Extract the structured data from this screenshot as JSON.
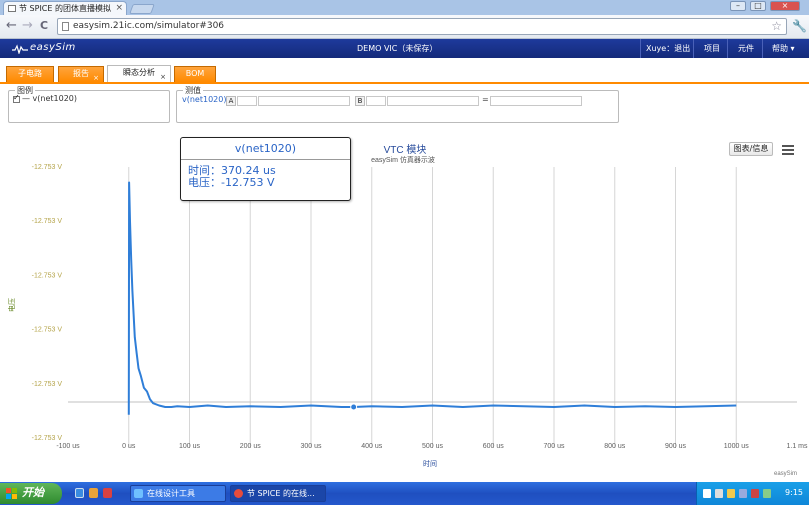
{
  "browser": {
    "tab_title": "节 SPICE 的团体直播模拟",
    "tab_close": "×",
    "url": "easysim.21ic.com/simulator#306",
    "nav_back": "←",
    "nav_forward": "→",
    "nav_reload": "C",
    "star": "☆",
    "wrench": "🔧",
    "win_min": "–",
    "win_max": "□",
    "win_close": "×"
  },
  "app": {
    "logo_text": "easySim",
    "center_title": "DEMO VIC（未保存）",
    "nav": [
      {
        "label": "Xuye：退出"
      },
      {
        "label": "项目"
      },
      {
        "label": "元件"
      },
      {
        "label": "帮助 ▾"
      }
    ]
  },
  "tabs": [
    {
      "label": "子电路",
      "closable": false,
      "active": false
    },
    {
      "label": "报告",
      "closable": true,
      "active": false
    },
    {
      "label": "瞬态分析",
      "closable": true,
      "active": true
    },
    {
      "label": "BOM",
      "closable": false,
      "active": false
    }
  ],
  "signals_panel": {
    "legend": "图例",
    "item": "— v(net1020)"
  },
  "calc_panel": {
    "legend": "测值",
    "signal": "v(net1020)",
    "a_label": "A",
    "b_label": "B",
    "eq": "="
  },
  "chart_tools": {
    "reset_label": "图表/信息",
    "menu_icon": "menu-icon"
  },
  "tooltip": {
    "series": "v(net1020)",
    "time_line": "时间：370.24 us",
    "value_line": "电压：-12.753 V"
  },
  "chart_data": {
    "type": "line",
    "title": "VTC 模块",
    "subtitle": "easySim 仿真器示波",
    "xlabel": "时间",
    "ylabel": "电压",
    "xlim": [
      -100,
      1100
    ],
    "ylim": [
      -12.75335,
      -12.753
    ],
    "x_ticks": [
      "-100 us",
      "0 us",
      "100 us",
      "200 us",
      "300 us",
      "400 us",
      "500 us",
      "600 us",
      "700 us",
      "800 us",
      "900 us",
      "1000 us",
      "1.1 ms"
    ],
    "y_ticks": [
      "-12.753 V",
      "-12.753 V",
      "-12.753 V",
      "-12.753 V",
      "-12.753 V",
      "-12.753 V"
    ],
    "credit": "easySim",
    "series": [
      {
        "color": "#2f7ed8",
        "x": [
          0,
          0.5,
          2,
          4,
          6,
          8,
          10,
          13,
          16,
          20,
          25,
          30,
          35,
          40,
          50,
          60,
          70,
          80,
          100,
          130,
          160,
          200,
          250,
          300,
          350,
          370.24,
          400,
          450,
          500,
          550,
          600,
          650,
          700,
          750,
          800,
          850,
          900,
          950,
          1000
        ],
        "y": [
          -12.75332,
          -12.75302,
          -12.75307,
          -12.75312,
          -12.75316,
          -12.75319,
          -12.75322,
          -12.75324,
          -12.75326,
          -12.75327,
          -12.753285,
          -12.75329,
          -12.7533,
          -12.753305,
          -12.753308,
          -12.75331,
          -12.75331,
          -12.753309,
          -12.75331,
          -12.753308,
          -12.75331,
          -12.753309,
          -12.75331,
          -12.753308,
          -12.75331,
          -12.75331,
          -12.753309,
          -12.75331,
          -12.753308,
          -12.75331,
          -12.753308,
          -12.753309,
          -12.75331,
          -12.753308,
          -12.75331,
          -12.753309,
          -12.75331,
          -12.753309,
          -12.753308
        ]
      }
    ],
    "marker_index": 25,
    "grid": true,
    "legend": "none"
  },
  "taskbar": {
    "start_label": "开始",
    "items": [
      {
        "label": "在线设计工具"
      },
      {
        "label": "节 SPICE 的在线..."
      }
    ],
    "clock": "9:15"
  }
}
